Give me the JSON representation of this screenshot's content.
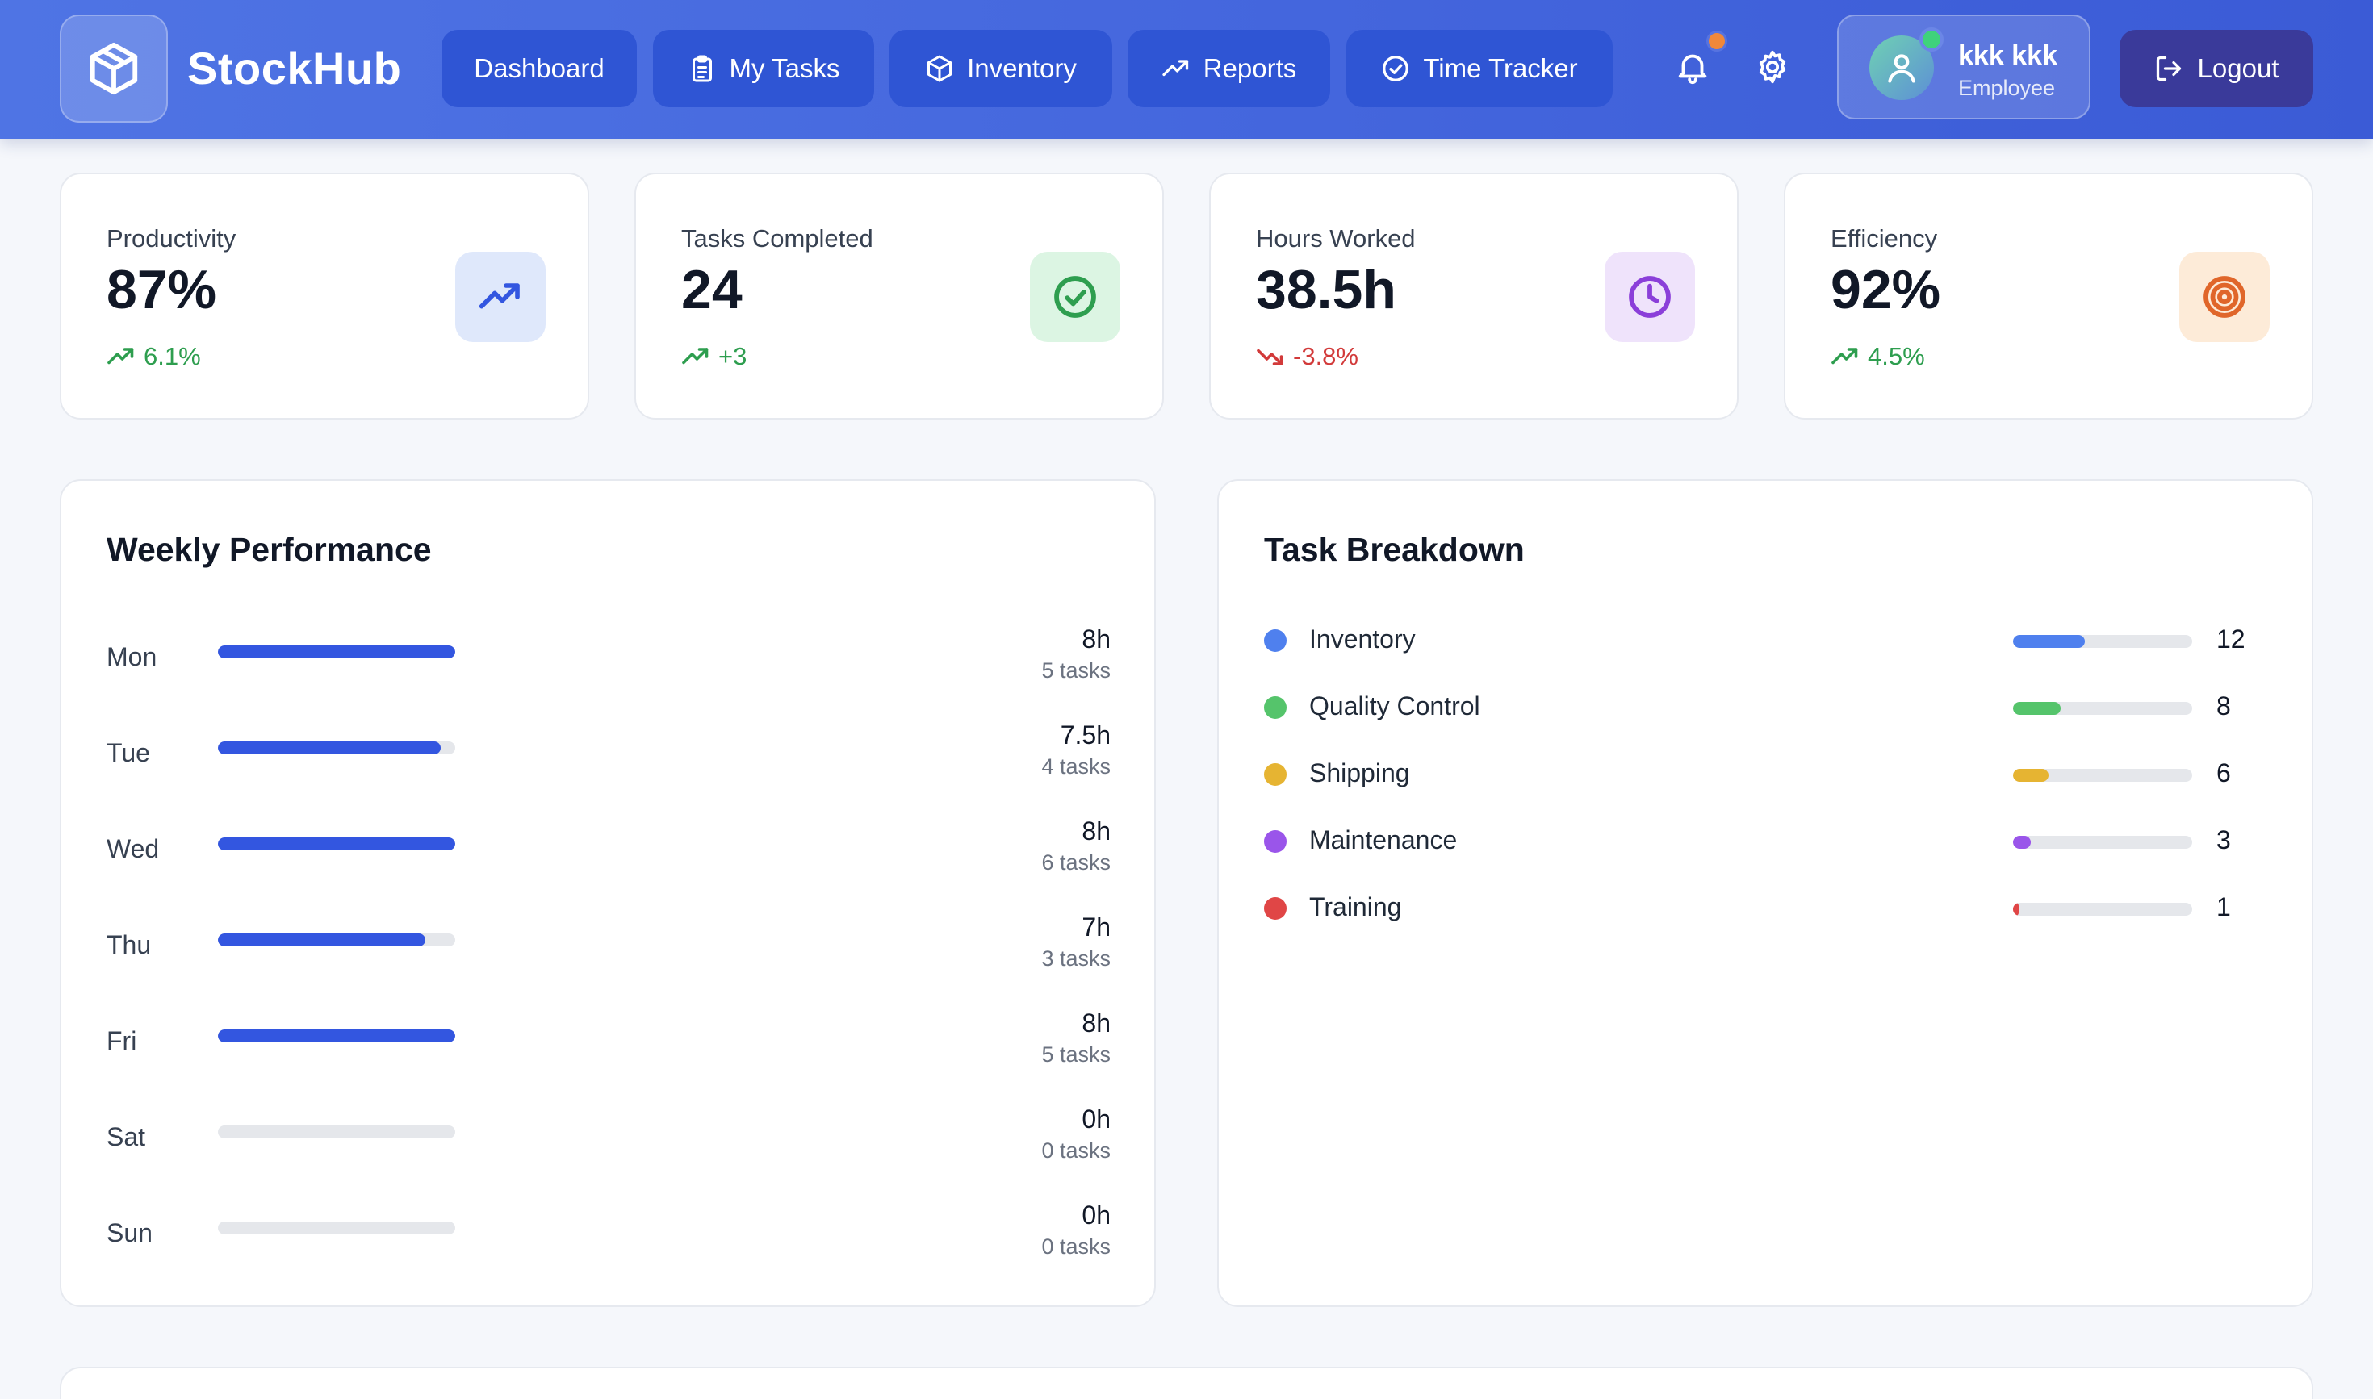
{
  "header": {
    "brand": "StockHub",
    "logo_icon": "cube-icon",
    "nav": [
      {
        "label": "Dashboard",
        "icon": ""
      },
      {
        "label": "My Tasks",
        "icon": "clipboard-icon"
      },
      {
        "label": "Inventory",
        "icon": "box-icon"
      },
      {
        "label": "Reports",
        "icon": "trending-up-icon"
      },
      {
        "label": "Time Tracker",
        "icon": "check-circle-icon"
      }
    ],
    "notification_icon": "bell-icon",
    "settings_icon": "gear-icon",
    "user": {
      "name": "kkk kkk",
      "role": "Employee"
    },
    "logout_label": "Logout"
  },
  "stats": [
    {
      "label": "Productivity",
      "value": "87%",
      "delta": "6.1%",
      "trend": "up",
      "icon": "trending-up-icon",
      "icon_bg": "#dfe8fb",
      "icon_color": "#3356e0"
    },
    {
      "label": "Tasks Completed",
      "value": "24",
      "delta": "+3",
      "trend": "up",
      "icon": "check-circle-icon",
      "icon_bg": "#dcf5e3",
      "icon_color": "#2e9e4f"
    },
    {
      "label": "Hours Worked",
      "value": "38.5h",
      "delta": "-3.8%",
      "trend": "down",
      "icon": "clock-icon",
      "icon_bg": "#efe3fb",
      "icon_color": "#8b3fd9"
    },
    {
      "label": "Efficiency",
      "value": "92%",
      "delta": "4.5%",
      "trend": "up",
      "icon": "target-icon",
      "icon_bg": "#fdebd8",
      "icon_color": "#e0662a"
    }
  ],
  "weekly": {
    "title": "Weekly Performance",
    "max_hours": 8,
    "days": [
      {
        "day": "Mon",
        "hours": 8,
        "hours_label": "8h",
        "tasks_label": "5 tasks"
      },
      {
        "day": "Tue",
        "hours": 7.5,
        "hours_label": "7.5h",
        "tasks_label": "4 tasks"
      },
      {
        "day": "Wed",
        "hours": 8,
        "hours_label": "8h",
        "tasks_label": "6 tasks"
      },
      {
        "day": "Thu",
        "hours": 7,
        "hours_label": "7h",
        "tasks_label": "3 tasks"
      },
      {
        "day": "Fri",
        "hours": 8,
        "hours_label": "8h",
        "tasks_label": "5 tasks"
      },
      {
        "day": "Sat",
        "hours": 0,
        "hours_label": "0h",
        "tasks_label": "0 tasks"
      },
      {
        "day": "Sun",
        "hours": 0,
        "hours_label": "0h",
        "tasks_label": "0 tasks"
      }
    ]
  },
  "breakdown": {
    "title": "Task Breakdown",
    "max": 30,
    "items": [
      {
        "label": "Inventory",
        "count": 12,
        "color": "#4f80ee"
      },
      {
        "label": "Quality Control",
        "count": 8,
        "color": "#55c46b"
      },
      {
        "label": "Shipping",
        "count": 6,
        "color": "#e6b432"
      },
      {
        "label": "Maintenance",
        "count": 3,
        "color": "#9a55ea"
      },
      {
        "label": "Training",
        "count": 1,
        "color": "#e04646"
      }
    ]
  }
}
